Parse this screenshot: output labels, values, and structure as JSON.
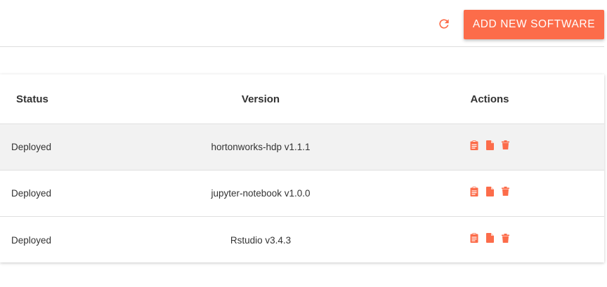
{
  "toolbar": {
    "refresh_icon": "refresh-icon",
    "add_button_label": "ADD NEW SOFTWARE",
    "accent_color": "#fc6c4a"
  },
  "table": {
    "columns": {
      "status": "Status",
      "version": "Version",
      "actions": "Actions"
    },
    "rows": [
      {
        "status": "Deployed",
        "version": "hortonworks-hdp v1.1.1",
        "actions": [
          "clipboard-icon",
          "file-icon",
          "trash-icon"
        ]
      },
      {
        "status": "Deployed",
        "version": "jupyter-notebook v1.0.0",
        "actions": [
          "clipboard-icon",
          "file-icon",
          "trash-icon"
        ]
      },
      {
        "status": "Deployed",
        "version": "Rstudio v3.4.3",
        "actions": [
          "clipboard-icon",
          "file-icon",
          "trash-icon"
        ]
      }
    ]
  }
}
